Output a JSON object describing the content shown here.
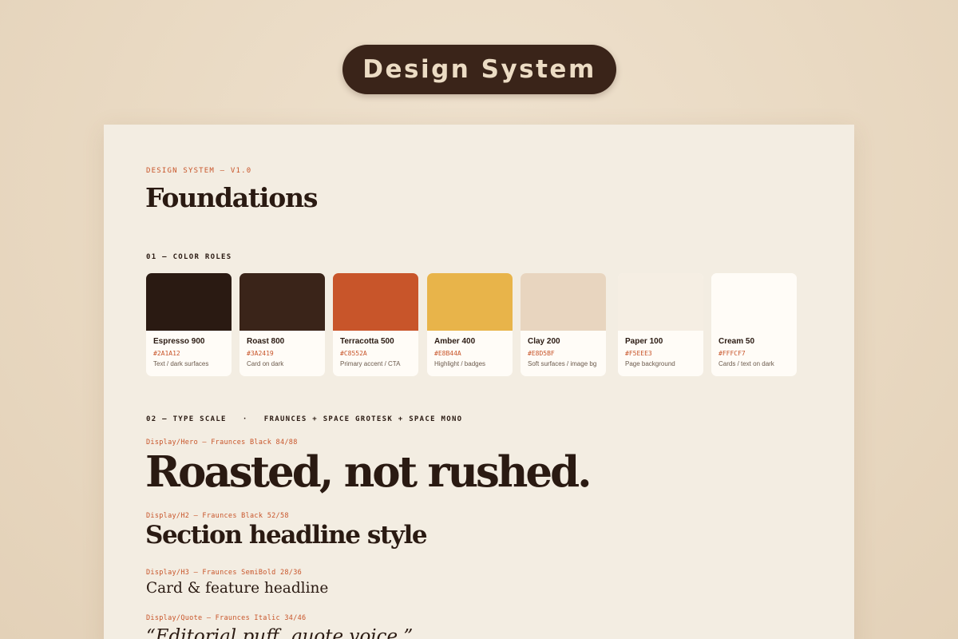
{
  "header": {
    "pill_title": "Design System"
  },
  "page": {
    "eyebrow": "DESIGN SYSTEM — V1.0",
    "title": "Foundations"
  },
  "colors": {
    "section_label": "01 — COLOR ROLES",
    "swatches": [
      {
        "name": "Espresso 900",
        "hex": "#2A1A12",
        "role": "Text / dark surfaces",
        "color": "#2A1A12"
      },
      {
        "name": "Roast 800",
        "hex": "#3A2419",
        "role": "Card on dark",
        "color": "#3A2419"
      },
      {
        "name": "Terracotta 500",
        "hex": "#C8552A",
        "role": "Primary accent / CTA",
        "color": "#C8552A"
      },
      {
        "name": "Amber 400",
        "hex": "#E8B44A",
        "role": "Highlight / badges",
        "color": "#E8B44A"
      },
      {
        "name": "Clay 200",
        "hex": "#E8D5BF",
        "role": "Soft surfaces / image bg",
        "color": "#E8D5BF"
      },
      {
        "name": "Paper 100",
        "hex": "#F5EEE3",
        "role": "Page background",
        "color": "#F5EEE3"
      },
      {
        "name": "Cream 50",
        "hex": "#FFFCF7",
        "role": "Cards / text on dark",
        "color": "#FFFCF7"
      }
    ]
  },
  "type_scale": {
    "section_label": "02 — TYPE SCALE   ·   FRAUNCES + SPACE GROTESK + SPACE MONO",
    "hero_spec": "Display/Hero — Fraunces Black 84/88",
    "hero_sample": "Roasted, not rushed.",
    "h2_spec": "Display/H2 — Fraunces Black 52/58",
    "h2_sample": "Section headline style",
    "h3_spec": "Display/H3 — Fraunces SemiBold 28/36",
    "h3_sample": "Card & feature headline",
    "quote_spec": "Display/Quote — Fraunces Italic 34/46",
    "quote_sample": "“Editorial puff, quote voice.”"
  }
}
